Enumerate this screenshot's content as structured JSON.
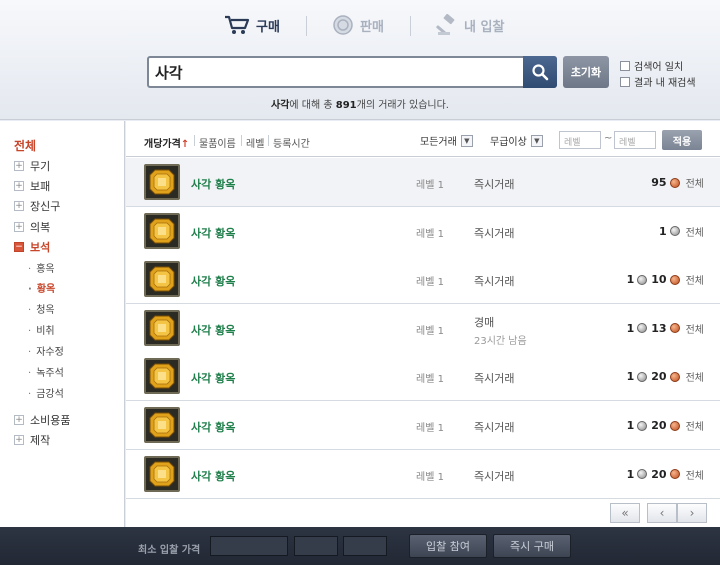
{
  "tabs": [
    {
      "label": "구매",
      "icon": "cart-icon",
      "active": true
    },
    {
      "label": "판매",
      "icon": "coin-icon",
      "active": false
    },
    {
      "label": "내 입찰",
      "icon": "gavel-icon",
      "active": false
    }
  ],
  "search": {
    "value": "사각",
    "reset_label": "초기화",
    "exact_label": "검색어 일치",
    "within_label": "결과 내 재검색"
  },
  "result": {
    "keyword": "사각",
    "text_a": "에 대해 총 ",
    "count": "891",
    "text_b": "개의 거래가 있습니다."
  },
  "sidebar": {
    "all_label": "전체",
    "categories": [
      {
        "label": "무기",
        "toggle": "+"
      },
      {
        "label": "보패",
        "toggle": "+"
      },
      {
        "label": "장신구",
        "toggle": "+"
      },
      {
        "label": "의복",
        "toggle": "+"
      },
      {
        "label": "보석",
        "toggle": "−"
      },
      {
        "label": "소비용품",
        "toggle": "+"
      },
      {
        "label": "제작",
        "toggle": "+"
      }
    ],
    "subcategories": [
      "홍옥",
      "황옥",
      "청옥",
      "비취",
      "자수정",
      "녹주석",
      "금강석"
    ]
  },
  "sortbar": {
    "sort_price": "개당가격",
    "sort_price_arrow": "↑",
    "sort_name": "물품이름",
    "sort_level": "레벨",
    "sort_time": "등록시간",
    "trade_filter": "모든거래",
    "grade_filter": "무급이상",
    "level_min_placeholder": "레벨",
    "level_max_placeholder": "레벨",
    "tilde": "~",
    "apply_label": "적용"
  },
  "rows": [
    {
      "name": "사각 황옥",
      "level": "레벨 1",
      "trade": "즉시거래",
      "remain": "",
      "silver": "",
      "copper": "95",
      "detail": "전체"
    },
    {
      "name": "사각 황옥",
      "level": "레벨 1",
      "trade": "즉시거래",
      "remain": "",
      "silver": "1",
      "copper": "",
      "detail": "전체"
    },
    {
      "name": "사각 황옥",
      "level": "레벨 1",
      "trade": "즉시거래",
      "remain": "",
      "silver": "1",
      "copper": "10",
      "detail": "전체"
    },
    {
      "name": "사각 황옥",
      "level": "레벨 1",
      "trade": "경매",
      "remain": "23시간 남음",
      "silver": "1",
      "copper": "13",
      "detail": "전체"
    },
    {
      "name": "사각 황옥",
      "level": "레벨 1",
      "trade": "즉시거래",
      "remain": "",
      "silver": "1",
      "copper": "20",
      "detail": "전체"
    },
    {
      "name": "사각 황옥",
      "level": "레벨 1",
      "trade": "즉시거래",
      "remain": "",
      "silver": "1",
      "copper": "20",
      "detail": "전체"
    },
    {
      "name": "사각 황옥",
      "level": "레벨 1",
      "trade": "즉시거래",
      "remain": "",
      "silver": "1",
      "copper": "20",
      "detail": "전체"
    }
  ],
  "pager": {
    "first": "«",
    "prev": "‹",
    "next": "›"
  },
  "footer": {
    "bid_label": "최소 입찰 가격",
    "bid_button": "입찰 참여",
    "buy_button": "즉시 구매"
  },
  "colors": {
    "accent_red": "#c8452a",
    "item_green": "#1f7f4b",
    "search_blue": "#2f4b72"
  }
}
